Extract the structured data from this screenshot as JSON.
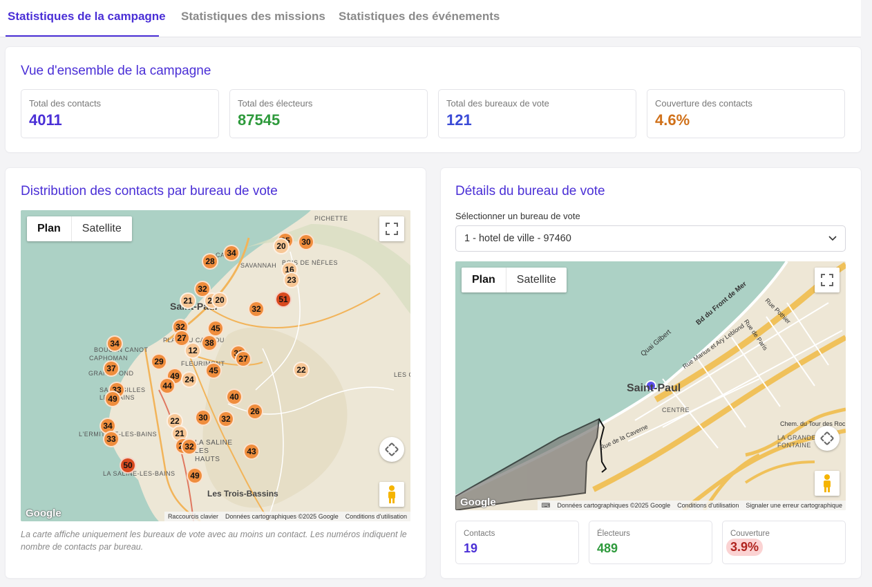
{
  "tabs": [
    "Statistiques de la campagne",
    "Statistiques des missions",
    "Statistiques des événements"
  ],
  "overview": {
    "title": "Vue d'ensemble de la campagne",
    "stats": [
      {
        "label": "Total des contacts",
        "value": "4011",
        "color": "#4a2fd6"
      },
      {
        "label": "Total des électeurs",
        "value": "87545",
        "color": "#2e9a3c"
      },
      {
        "label": "Total des bureaux de vote",
        "value": "121",
        "color": "#3a4ad6"
      },
      {
        "label": "Couverture des contacts",
        "value": "4.6%",
        "color": "#d0711a"
      }
    ]
  },
  "distribution": {
    "title": "Distribution des contacts par bureau de vote",
    "note": "La carte affiche uniquement les bureaux de vote avec au moins un contact. Les numéros indiquent le nombre de contacts par bureau.",
    "map": {
      "plan": "Plan",
      "satellite": "Satellite",
      "logo": "Google",
      "attrib": [
        "Raccourcis clavier",
        "Données cartographiques ©2025 Google",
        "Conditions d'utilisation"
      ],
      "labels": [
        "PICHETTE",
        "CAMB",
        "SAVANNAH",
        "BOIS DE NÈFLES",
        "Saint-Paul",
        "PLATEAU CAILLOU",
        "FLEURIMONT",
        "BOUCAN CANOT",
        "CAPHOMAN",
        "GRAND FOND",
        "SAINT-GILLES LES BAINS",
        "L'ERMITAGE-LES-BAINS",
        "LA SALINE-LES-BAINS",
        "LA SALINE LES HAUTS",
        "Les Trois-Bassins",
        "LES COLIMAÇONS"
      ],
      "markers": [
        "25",
        "30",
        "20",
        "34",
        "28",
        "16",
        "23",
        "32",
        "51",
        "21",
        "24",
        "20",
        "32",
        "32",
        "45",
        "27",
        "38",
        "12",
        "34",
        "30",
        "27",
        "29",
        "45",
        "22",
        "37",
        "49",
        "24",
        "44",
        "33",
        "49",
        "40",
        "26",
        "22",
        "30",
        "32",
        "34",
        "21",
        "33",
        "27",
        "32",
        "43",
        "50",
        "49"
      ]
    }
  },
  "details": {
    "title": "Détails du bureau de vote",
    "select_label": "Sélectionner un bureau de vote",
    "selected": "1 - hotel de ville - 97460",
    "map": {
      "plan": "Plan",
      "satellite": "Satellite",
      "logo": "Google",
      "attrib": [
        "Données cartographiques ©2025 Google",
        "Conditions d'utilisation",
        "Signaler une erreur cartographique"
      ],
      "labels": [
        "Saint-Paul",
        "CENTRE",
        "LA GRANDE FONTAINE",
        "Quai Gilbert",
        "Bd du Front de Mer",
        "Rue Marius et Ary Leblond",
        "Rue Pothier",
        "Rue de Paris",
        "Rue de la Caverne",
        "Chem. du Tour des Roches"
      ]
    },
    "stats": [
      {
        "label": "Contacts",
        "value": "19",
        "color": "#4a2fd6"
      },
      {
        "label": "Électeurs",
        "value": "489",
        "color": "#2e9a3c"
      },
      {
        "label": "Couverture",
        "value": "3.9%",
        "color": "#b0231e"
      }
    ]
  }
}
